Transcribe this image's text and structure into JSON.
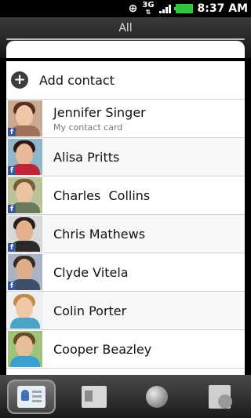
{
  "status_bar": {
    "network": "3G",
    "time": "8:37 AM",
    "icons": [
      "gps-icon",
      "3g-icon",
      "signal-icon",
      "battery-icon"
    ]
  },
  "header": {
    "title": "All"
  },
  "list": {
    "add_contact": "Add contact",
    "contacts": [
      {
        "name": "Jennifer Singer",
        "subtitle": "My contact card",
        "facebook": true
      },
      {
        "name": "Alisa Pritts",
        "subtitle": "",
        "facebook": true
      },
      {
        "name": "Charles  Collins",
        "subtitle": "",
        "facebook": true
      },
      {
        "name": "Chris Mathews",
        "subtitle": "",
        "facebook": true
      },
      {
        "name": "Clyde Vitela",
        "subtitle": "",
        "facebook": true
      },
      {
        "name": "Colin Porter",
        "subtitle": "",
        "facebook": false
      },
      {
        "name": "Cooper Beazley",
        "subtitle": "",
        "facebook": false
      }
    ],
    "facebook_badge": "f"
  },
  "bottom_tabs": [
    {
      "icon": "people-icon",
      "active": true
    },
    {
      "icon": "groups-icon",
      "active": false
    },
    {
      "icon": "online-directory-icon",
      "active": false
    },
    {
      "icon": "call-history-icon",
      "active": false
    }
  ]
}
